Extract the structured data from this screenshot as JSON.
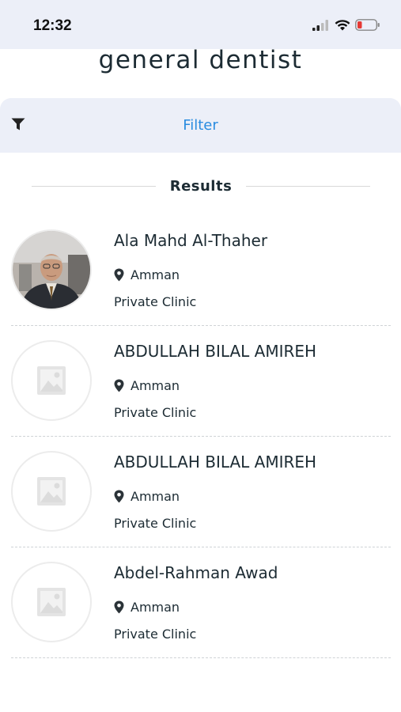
{
  "status_bar": {
    "time": "12:32"
  },
  "page": {
    "title": "general dentist"
  },
  "filter": {
    "label": "Filter"
  },
  "results": {
    "title": "Results"
  },
  "items": [
    {
      "name": "Ala Mahd Al-Thaher",
      "city": "Amman",
      "type": "Private Clinic",
      "avatar": "photo"
    },
    {
      "name": "ABDULLAH BILAL AMIREH",
      "city": "Amman",
      "type": "Private Clinic",
      "avatar": "placeholder-image-icon"
    },
    {
      "name": "ABDULLAH BILAL AMIREH",
      "city": "Amman",
      "type": "Private Clinic",
      "avatar": "placeholder-image-icon"
    },
    {
      "name": "Abdel-Rahman Awad",
      "city": "Amman",
      "type": "Private Clinic",
      "avatar": "placeholder-image-icon"
    }
  ],
  "colors": {
    "accent": "#2a8ce0",
    "bar_background": "#eceff8",
    "text": "#1c2b33",
    "battery_low": "#e53935"
  }
}
